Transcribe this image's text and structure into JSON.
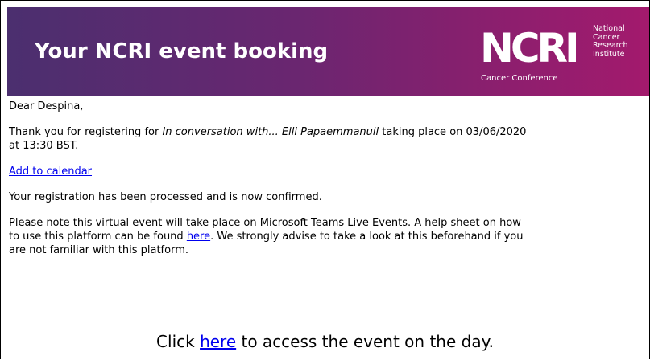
{
  "banner": {
    "title": "Your NCRI event booking",
    "logo_mark": "NCRI",
    "logo_words": [
      "National",
      "Cancer",
      "Research",
      "Institute"
    ],
    "logo_sub": "Cancer Conference"
  },
  "email": {
    "greeting": "Dear Despina,",
    "intro_prefix": "Thank you for registering for ",
    "event_name": "In conversation with... Elli Papaemmanuil",
    "intro_mid": " taking place on 03/06/2020",
    "intro_time": "at 13:30 BST.",
    "calendar_link": "Add to calendar",
    "confirmation": "Your registration has been processed and is now confirmed.",
    "note_line1": "Please note this virtual event will take place on Microsoft Teams Live Events. A help sheet on how",
    "note_line2_prefix": "to use this platform can be found ",
    "note_link": "here",
    "note_line2_suffix": ". We strongly advise to take a look at this beforehand if you",
    "note_line3": "are not familiar with this platform.",
    "cta_prefix": "Click ",
    "cta_link": "here",
    "cta_suffix": " to access the event on the day."
  },
  "colors": {
    "banner_start": "#4b2f6f",
    "banner_end": "#a31a6d",
    "link": "#0000ee"
  }
}
